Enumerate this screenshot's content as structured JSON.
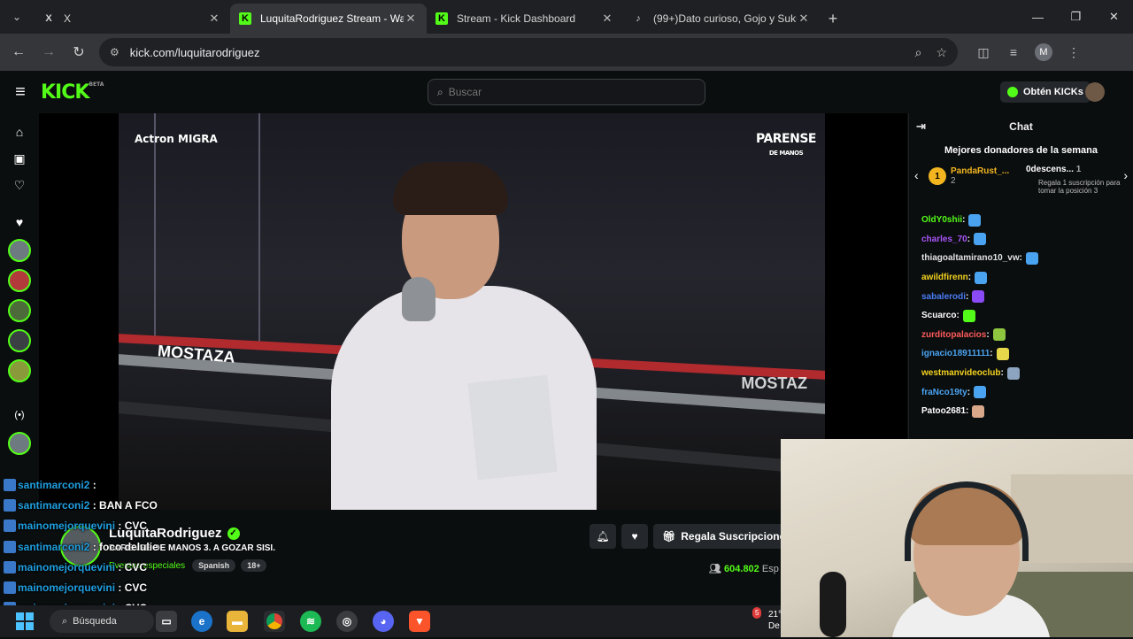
{
  "browser": {
    "tabs": [
      {
        "title": "X",
        "favicon": "X",
        "active": false
      },
      {
        "title": "LuquitaRodriguez Stream - Wat",
        "favicon": "K",
        "active": true
      },
      {
        "title": "Stream - Kick Dashboard",
        "favicon": "K",
        "active": false
      },
      {
        "title": "(99+)Dato curioso, Gojo y Suku",
        "favicon": "♪",
        "active": false
      }
    ],
    "url": "kick.com/luquitarodriguez",
    "profile_initial": "M"
  },
  "header": {
    "logo": "KICK",
    "logo_beta": "BETA",
    "search_placeholder": "Buscar",
    "kicks_button": "Obtén KICKs"
  },
  "player": {
    "brand_left": "Actron MIGRA",
    "brand_right": "PARENSE",
    "brand_right_sub": "DE MANOS",
    "ring_left": "MOSTAZA",
    "ring_right": "MOSTAZ"
  },
  "chat": {
    "title": "Chat",
    "donors_title": "Mejores donadores de la semana",
    "donor1": {
      "rank": "1",
      "name": "PandaRust_...",
      "count": "2"
    },
    "donor2": {
      "name": "0descens...",
      "count": "1"
    },
    "donor3_text": "Regala 1 suscripción para tomar la posición 3",
    "messages": [
      {
        "user": "OldY0shii",
        "color": "#53fc18",
        "emote_color": "#4aa3f0"
      },
      {
        "user": "charles_70",
        "color": "#a855f7",
        "emote_color": "#4aa3f0"
      },
      {
        "user": "thiagoaltamirano10_vw",
        "color": "#e3e3e3",
        "emote_color": "#4aa3f0"
      },
      {
        "user": "awildfirenn",
        "color": "#f2d21f",
        "emote_color": "#4aa3f0"
      },
      {
        "user": "sabalerodi",
        "color": "#4a7cf5",
        "emote_color": "#8a4af5"
      },
      {
        "user": "Scuarco",
        "color": "#ffffff",
        "emote_color": "#53fc18"
      },
      {
        "user": "zurditopalacios",
        "color": "#ff5a5a",
        "emote_color": "#8ec63f"
      },
      {
        "user": "ignacio18911111",
        "color": "#4aa3f0",
        "emote_color": "#e6d84a"
      },
      {
        "user": "westmanvideoclub",
        "color": "#f2d21f",
        "emote_color": "#8ca4c0"
      },
      {
        "user": "fraNco19ty",
        "color": "#4aa3f0",
        "emote_color": "#4aa3f0"
      },
      {
        "user": "Patoo2681",
        "color": "#ffffff",
        "emote_color": "#d9a88a"
      }
    ]
  },
  "overlay_chat": [
    {
      "user": "santimarconi2",
      "msg": ""
    },
    {
      "user": "santimarconi2",
      "msg": "BAN A FCO"
    },
    {
      "user": "mainomejorquevini",
      "msg": "CVC"
    },
    {
      "user": "santimarconi2",
      "msg": "foco delulie"
    },
    {
      "user": "mainomejorquevini",
      "msg": "CVC"
    },
    {
      "user": "mainomejorquevini",
      "msg": "CVC"
    },
    {
      "user": "mainomejorquevini",
      "msg": "CVC"
    },
    {
      "user": "mainomejorquevini",
      "msg": "CVC"
    }
  ],
  "stream": {
    "streamer": "LuquitaRodriguez",
    "title": "PARENSE DE MANOS 3. A GOZAR SISI.",
    "category": "Eventos especiales",
    "tags": [
      "Spanish",
      "18+"
    ],
    "subscribe_label": "Regala Suscripcione",
    "viewers": "604.802",
    "viewers_label": "Esp"
  },
  "taskbar": {
    "search": "Búsqueda",
    "weather_temp": "21°",
    "weather_sub": "De",
    "notif_count": "5"
  }
}
